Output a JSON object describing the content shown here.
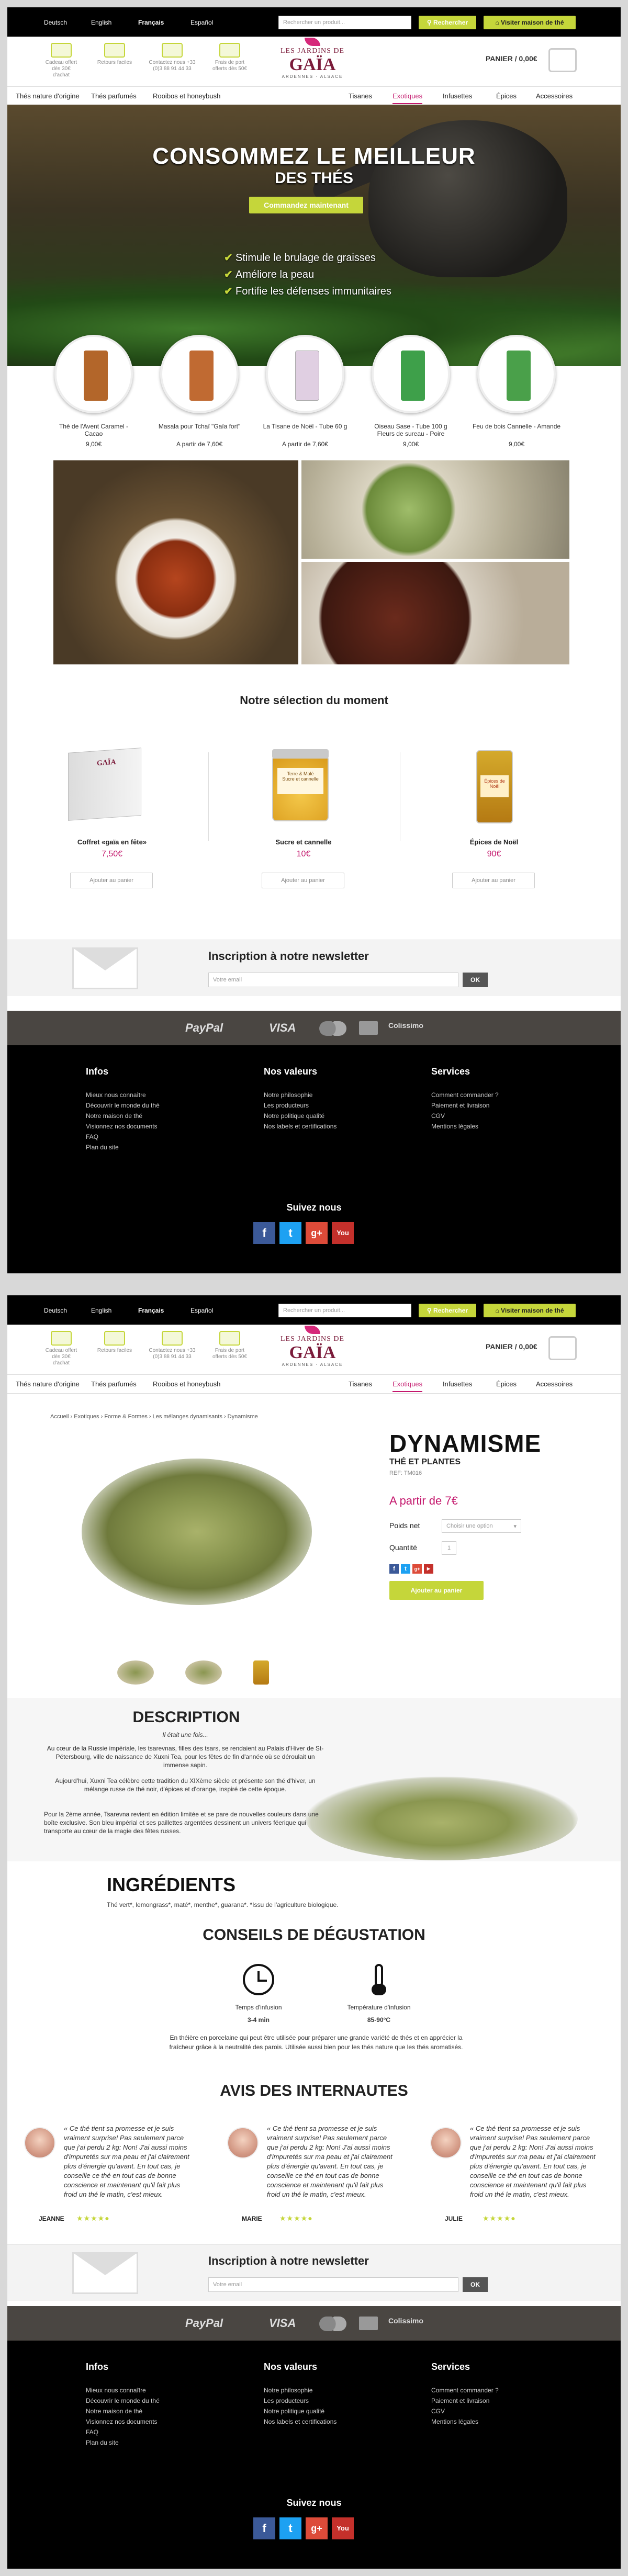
{
  "topbar": {
    "languages": [
      "Deutsch",
      "English",
      "Français",
      "Español"
    ],
    "active_language": "Français",
    "search_placeholder": "Rechercher un produit...",
    "search_button": "Rechercher",
    "visit_button": "Visiter maison de thé"
  },
  "header": {
    "features": [
      {
        "icon": "gift-icon",
        "label": "Cadeau offert dès 30€ d'achat"
      },
      {
        "icon": "plane-icon",
        "label": "Retours faciles"
      },
      {
        "icon": "phone-icon",
        "label": "Contactez nous +33 (0)3 88 91 44 33"
      },
      {
        "icon": "truck-icon",
        "label": "Frais de port offerts dès 50€"
      }
    ],
    "logo_top": "LES JARDINS DE",
    "logo_main": "GAÏA",
    "logo_sub": "ARDENNES · ALSACE",
    "cart": "PANIER / 0,00€"
  },
  "nav": [
    "Thés nature d'origine",
    "Thés parfumés",
    "Rooibos et honeybush",
    "Tisanes",
    "Exotiques",
    "Infusettes",
    "Épices",
    "Accessoires"
  ],
  "nav_active": "Exotiques",
  "hero": {
    "title": "Consommez le meilleur",
    "title2": "des thés",
    "cta": "Commandez maintenant",
    "bullets": [
      "Stimule le brulage de graisses",
      "Améliore la peau",
      "Fortifie les défenses immunitaires"
    ]
  },
  "featured_products": [
    {
      "name": "Thé de l'Avent Caramel - Cacao",
      "price": "9,00€",
      "color": "#b3662a"
    },
    {
      "name": "Masala pour Tchaï \"Gaïa fort\"",
      "price": "A partir de 7,60€",
      "color": "#c06a32"
    },
    {
      "name": "La Tisane de Noël - Tube 60 g",
      "price": "A partir de 7,60€",
      "color": "#e0cfe2"
    },
    {
      "name": "Oiseau Sase - Tube 100 g Fleurs de sureau - Poire",
      "price": "9,00€",
      "color": "#3ea04a"
    },
    {
      "name": "Feu de bois Cannelle - Amande",
      "price": "9,00€",
      "color": "#4aa04a"
    }
  ],
  "selection": {
    "title": "Notre sélection du moment",
    "items": [
      {
        "name": "Coffret «gaïa en fête»",
        "price": "7,50€",
        "button": "Ajouter au panier"
      },
      {
        "name": "Sucre et cannelle",
        "price": "10€",
        "button": "Ajouter au panier"
      },
      {
        "name": "Épices de Noël",
        "price": "90€",
        "button": "Ajouter au panier"
      }
    ],
    "jar_label_top": "Terre & Malé",
    "jar_label_bottom": "Sucre et cannelle",
    "box_label": "GAÏA",
    "spice_label": "Épices de Noël"
  },
  "newsletter": {
    "title": "Inscription à notre newsletter",
    "placeholder": "Votre email",
    "button": "OK"
  },
  "payments": [
    "PayPal",
    "VISA",
    "MasterCard",
    "Colissimo"
  ],
  "footer": {
    "infos": {
      "title": "Infos",
      "links": [
        "Mieux nous connaître",
        "Découvrir le monde du thé",
        "Notre maison de thé",
        "Visionnez nos documents",
        "FAQ",
        "Plan du site"
      ]
    },
    "valeurs": {
      "title": "Nos valeurs",
      "links": [
        "Notre philosophie",
        "Les producteurs",
        "Notre politique qualité",
        "Nos labels et certifications"
      ]
    },
    "services": {
      "title": "Services",
      "links": [
        "Comment commander ?",
        "Paiement et livraison",
        "CGV",
        "Mentions légales"
      ]
    },
    "follow": "Suivez nous"
  },
  "product": {
    "breadcrumb": "Accueil › Exotiques › Forme & Formes › Les mélanges dynamisants › Dynamisme",
    "name": "DYNAMISME",
    "category": "THÉ ET PLANTES",
    "ref": "REF: TM016",
    "from_price": "A partir de 7€",
    "weight_label": "Poids net",
    "weight_placeholder": "Choisir une option",
    "qty_label": "Quantité",
    "qty": "1",
    "add": "Ajouter au panier",
    "share": [
      "f",
      "t",
      "g+",
      "yt"
    ]
  },
  "description": {
    "title": "DESCRIPTION",
    "p0": "Il était une fois...",
    "p1": "Au cœur de la Russie impériale, les tsarevnas, filles des tsars, se rendaient au Palais d'Hiver de St-Pétersbourg, ville de naissance de Xuxni Tea, pour les fêtes de fin d'année où se déroulait un immense sapin.",
    "p2": "Aujourd'hui, Xuxni Tea célèbre cette tradition du XIXème siècle et présente son thé d'hiver, un mélange russe de thé noir, d'épices et d'orange, inspiré de cette époque.",
    "p3": "Pour la 2ème année, Tsarevna revient en édition limitée et se pare de nouvelles couleurs dans une boîte exclusive. Son bleu impérial et ses paillettes argentées dessinent un univers féerique qui transporte au cœur de la magie des fêtes russes."
  },
  "ingredients": {
    "title": "INGRÉDIENTS",
    "text": "Thé vert*, lemongrass*, maté*, menthe*, guarana*. *Issu de l'agriculture biologique."
  },
  "conseils": {
    "title": "CONSEILS DE DÉGUSTATION",
    "time_label": "Temps d'infusion",
    "time_value": "3-4 min",
    "temp_label": "Température d'infusion",
    "temp_value": "85-90°C",
    "text": "En théière en porcelaine qui peut être utilisée pour préparer une grande variété de thés et en apprécier la fraîcheur grâce à la neutralité des parois. Utilisée aussi bien pour les thés nature que les thés aromatisés."
  },
  "reviews": {
    "title": "AVIS DES INTERNAUTES",
    "items": [
      {
        "name": "JEANNE",
        "text": "« Ce thé tient sa promesse et je suis vraiment surprise! Pas seulement parce que j'ai perdu 2 kg: Non! J'ai aussi moins d'impuretés sur ma peau et j'ai clairement plus d'énergie qu'avant. En tout cas, je conseille ce thé en tout cas de bonne conscience et maintenant qu'il fait plus froid un thé le matin, c'est mieux.",
        "stars": "★★★★●"
      },
      {
        "name": "MARIE",
        "text": "« Ce thé tient sa promesse et je suis vraiment surprise! Pas seulement parce que j'ai perdu 2 kg: Non! J'ai aussi moins d'impuretés sur ma peau et j'ai clairement plus d'énergie qu'avant. En tout cas, je conseille ce thé en tout cas de bonne conscience et maintenant qu'il fait plus froid un thé le matin, c'est mieux.",
        "stars": "★★★★●"
      },
      {
        "name": "JULIE",
        "text": "« Ce thé tient sa promesse et je suis vraiment surprise! Pas seulement parce que j'ai perdu 2 kg: Non! J'ai aussi moins d'impuretés sur ma peau et j'ai clairement plus d'énergie qu'avant. En tout cas, je conseille ce thé en tout cas de bonne conscience et maintenant qu'il fait plus froid un thé le matin, c'est mieux.",
        "stars": "★★★★●"
      }
    ]
  },
  "colors": {
    "accent": "#c5d63a",
    "brand": "#c4186d",
    "logo": "#7b1b3a"
  }
}
